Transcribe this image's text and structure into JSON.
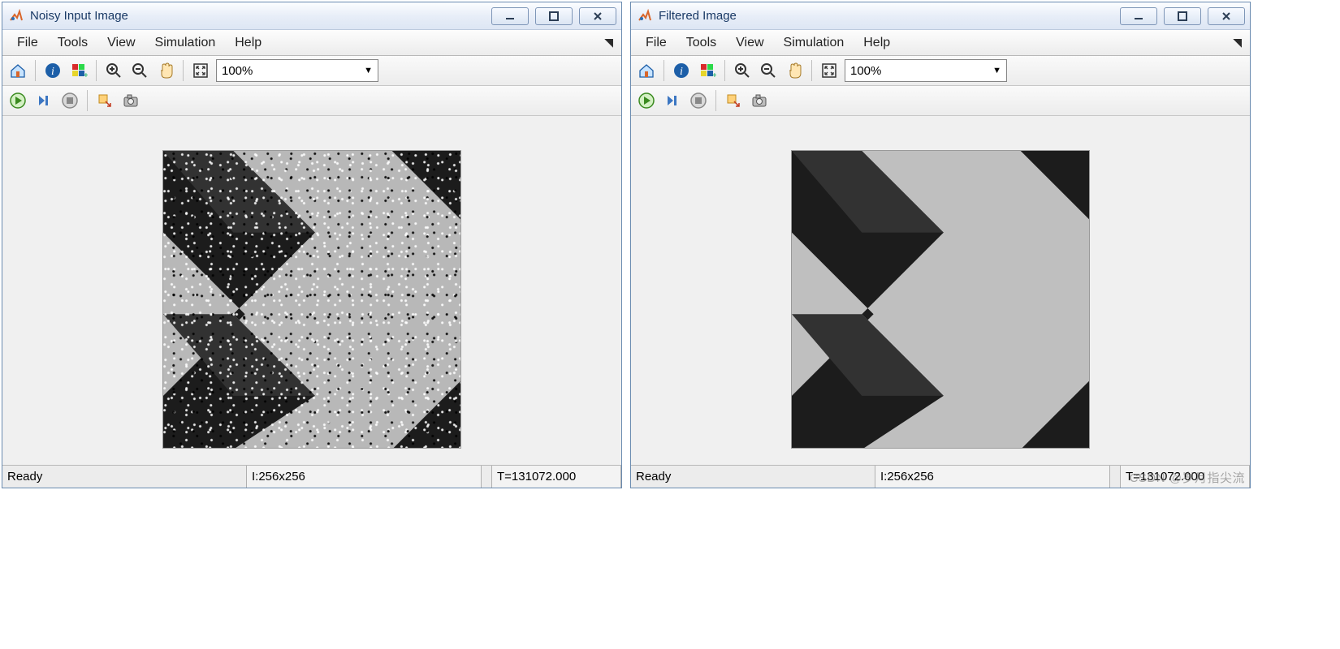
{
  "windows": [
    {
      "title": "Noisy Input Image",
      "noisy": true
    },
    {
      "title": "Filtered Image",
      "noisy": false
    }
  ],
  "menu": {
    "items": [
      "File",
      "Tools",
      "View",
      "Simulation",
      "Help"
    ]
  },
  "toolbar": {
    "zoom_value": "100%"
  },
  "status": {
    "ready": "Ready",
    "dim": "I:256x256",
    "time": "T=131072.000"
  },
  "watermark": "CSDN @岁月指尖流"
}
